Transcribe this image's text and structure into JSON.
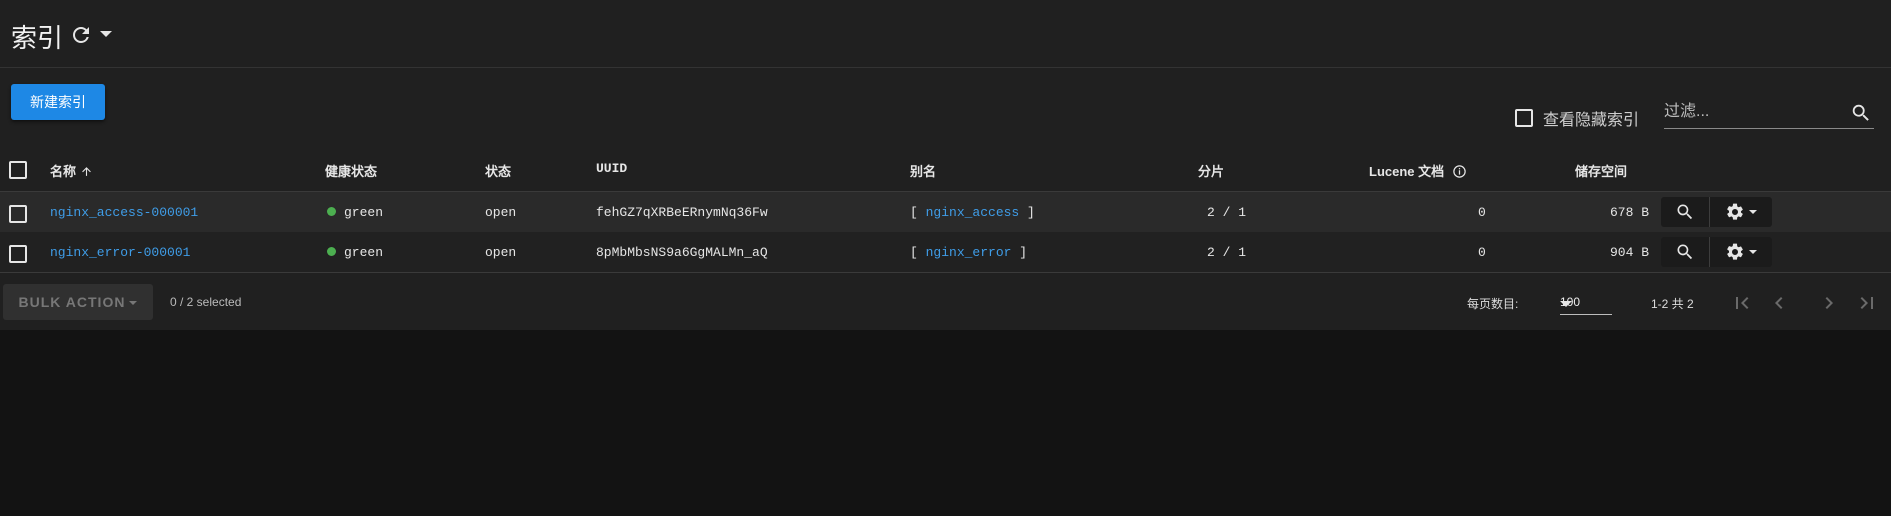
{
  "header": {
    "title": "索引",
    "refresh_icon": "refresh-icon",
    "menu_icon": "caret-down-icon"
  },
  "toolbar": {
    "new_button": "新建索引",
    "show_hidden_label": "查看隐藏索引",
    "show_hidden_checked": false,
    "filter_placeholder": "过滤..."
  },
  "table": {
    "columns": {
      "name": "名称",
      "health": "健康状态",
      "status": "状态",
      "uuid": "UUID",
      "aliases": "别名",
      "shards": "分片",
      "docs": "Lucene 文档",
      "storage": "储存空间"
    },
    "sort": {
      "column": "name",
      "direction": "asc"
    },
    "rows": [
      {
        "name": "nginx_access-000001",
        "health": "green",
        "status": "open",
        "uuid": "fehGZ7qXRBeERnymNq36Fw",
        "alias": "nginx_access",
        "shards": "2 / 1",
        "docs": "0",
        "storage": "678 B"
      },
      {
        "name": "nginx_error-000001",
        "health": "green",
        "status": "open",
        "uuid": "8pMbMbsNS9a6GgMALMn_aQ",
        "alias": "nginx_error",
        "shards": "2 / 1",
        "docs": "0",
        "storage": "904 B"
      }
    ]
  },
  "footer": {
    "bulk_action": "BULK ACTION",
    "selected": "0 / 2 selected",
    "per_page_label": "每页数目:",
    "per_page_value": "100",
    "range": "1-2 共 2"
  },
  "colors": {
    "accent": "#1e88e5",
    "link": "#3f9de8",
    "health_green": "#4caf50",
    "panel": "#202020",
    "page": "#131313"
  }
}
